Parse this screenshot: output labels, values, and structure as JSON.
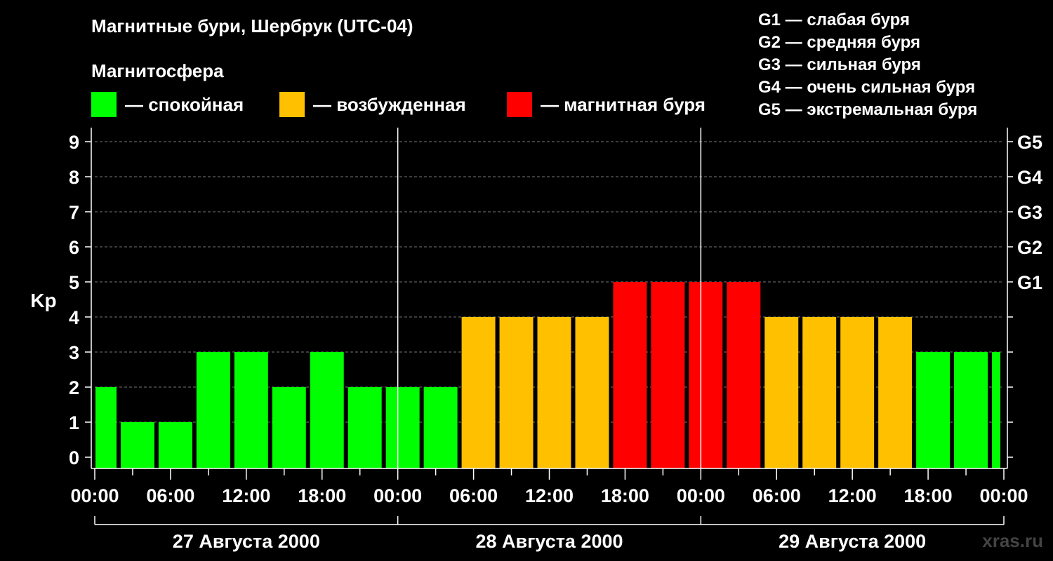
{
  "title": "Магнитные бури, Шербрук (UTC-04)",
  "legend": {
    "heading": "Магнитосфера",
    "items": [
      {
        "label": "— спокойная",
        "color": "#00ff00"
      },
      {
        "label": "— возбужденная",
        "color": "#ffc000"
      },
      {
        "label": "— магнитная буря",
        "color": "#ff0000"
      }
    ]
  },
  "g_levels": [
    "G1 — слабая буря",
    "G2 — средняя буря",
    "G3 — сильная буря",
    "G4 — очень сильная буря",
    "G5 — экстремальная буря"
  ],
  "watermark": "xras.ru",
  "chart_data": {
    "type": "bar",
    "title": "Магнитные бури, Шербрук (UTC-04)",
    "ylabel": "Kp",
    "ylim": [
      0,
      9
    ],
    "yticks": [
      "0",
      "1",
      "2",
      "3",
      "4",
      "5",
      "6",
      "7",
      "8",
      "9"
    ],
    "right_ticks": [
      {
        "value": 5,
        "label": "G1"
      },
      {
        "value": 6,
        "label": "G2"
      },
      {
        "value": 7,
        "label": "G3"
      },
      {
        "value": 8,
        "label": "G4"
      },
      {
        "value": 9,
        "label": "G5"
      }
    ],
    "x_range_hours": [
      0,
      72
    ],
    "xtick_labels": [
      "00:00",
      "06:00",
      "12:00",
      "18:00",
      "00:00",
      "06:00",
      "12:00",
      "18:00",
      "00:00",
      "06:00",
      "12:00",
      "18:00",
      "00:00"
    ],
    "days": [
      "27 Августа 2000",
      "28 Августа 2000",
      "29 Августа 2000"
    ],
    "bars": [
      {
        "start": 0,
        "end": 2,
        "kp": 2
      },
      {
        "start": 2,
        "end": 5,
        "kp": 1
      },
      {
        "start": 5,
        "end": 8,
        "kp": 1
      },
      {
        "start": 8,
        "end": 11,
        "kp": 3
      },
      {
        "start": 11,
        "end": 14,
        "kp": 3
      },
      {
        "start": 14,
        "end": 17,
        "kp": 2
      },
      {
        "start": 17,
        "end": 20,
        "kp": 3
      },
      {
        "start": 20,
        "end": 23,
        "kp": 2
      },
      {
        "start": 23,
        "end": 26,
        "kp": 2
      },
      {
        "start": 26,
        "end": 29,
        "kp": 2
      },
      {
        "start": 29,
        "end": 32,
        "kp": 4
      },
      {
        "start": 32,
        "end": 35,
        "kp": 4
      },
      {
        "start": 35,
        "end": 38,
        "kp": 4
      },
      {
        "start": 38,
        "end": 41,
        "kp": 4
      },
      {
        "start": 41,
        "end": 44,
        "kp": 5
      },
      {
        "start": 44,
        "end": 47,
        "kp": 5
      },
      {
        "start": 47,
        "end": 50,
        "kp": 5
      },
      {
        "start": 50,
        "end": 53,
        "kp": 5
      },
      {
        "start": 53,
        "end": 56,
        "kp": 4
      },
      {
        "start": 56,
        "end": 59,
        "kp": 4
      },
      {
        "start": 59,
        "end": 62,
        "kp": 4
      },
      {
        "start": 62,
        "end": 65,
        "kp": 4
      },
      {
        "start": 65,
        "end": 68,
        "kp": 3
      },
      {
        "start": 68,
        "end": 71,
        "kp": 3
      },
      {
        "start": 71,
        "end": 72,
        "kp": 3
      }
    ],
    "grid": true,
    "legend_position": "top"
  }
}
